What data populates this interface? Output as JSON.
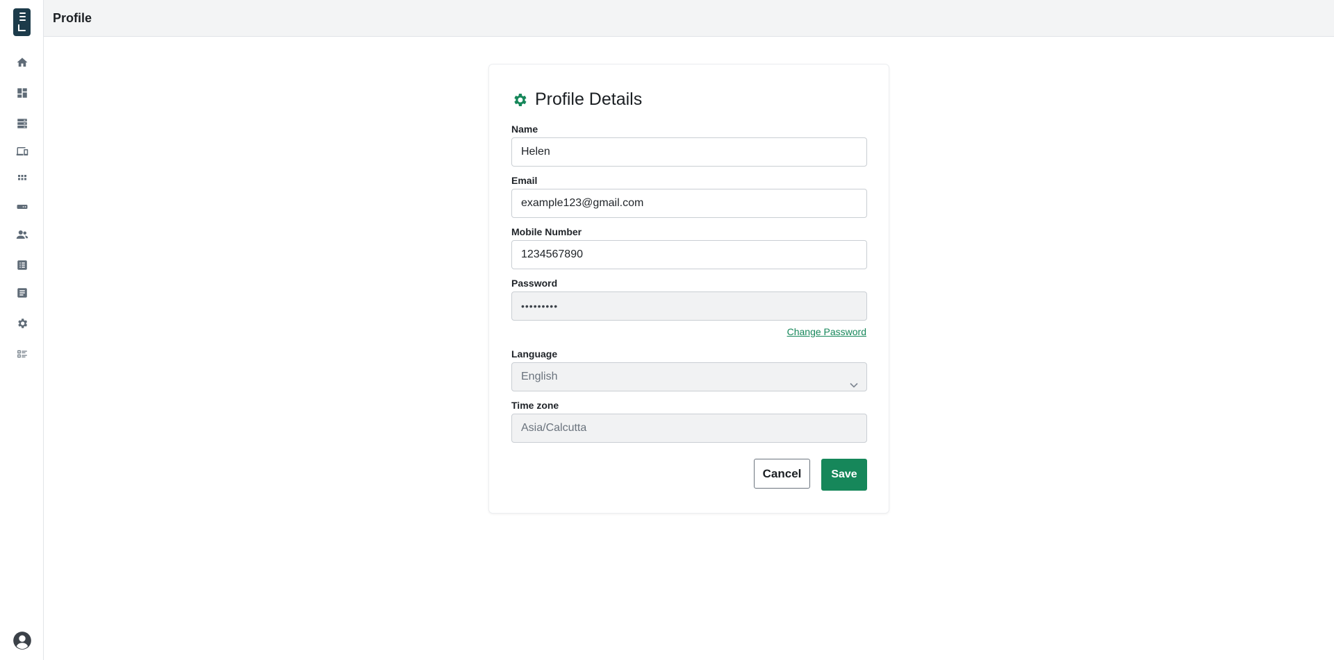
{
  "topbar": {
    "title": "Profile"
  },
  "sidebar": {
    "icons": [
      "home-icon",
      "dashboard-icon",
      "server-icon",
      "devices-icon",
      "apps-grid-icon",
      "ticket-icon",
      "users-icon",
      "list-icon",
      "document-icon",
      "gear-icon",
      "checklist-icon"
    ],
    "footer_icon": "user-circle-icon"
  },
  "card": {
    "title": "Profile Details",
    "icon": "gear-icon",
    "fields": {
      "name": {
        "label": "Name",
        "value": "Helen"
      },
      "email": {
        "label": "Email",
        "value": "example123@gmail.com"
      },
      "mobile": {
        "label": "Mobile Number",
        "value": "1234567890"
      },
      "password": {
        "label": "Password",
        "value": "•••••••••"
      },
      "language": {
        "label": "Language",
        "value": "English"
      },
      "timezone": {
        "label": "Time zone",
        "value": "Asia/Calcutta"
      }
    },
    "change_password": "Change Password",
    "cancel_label": "Cancel",
    "save_label": "Save"
  },
  "colors": {
    "accent": "#16875a",
    "logo": "#1c3b4a",
    "topbar": "#f3f4f5"
  }
}
